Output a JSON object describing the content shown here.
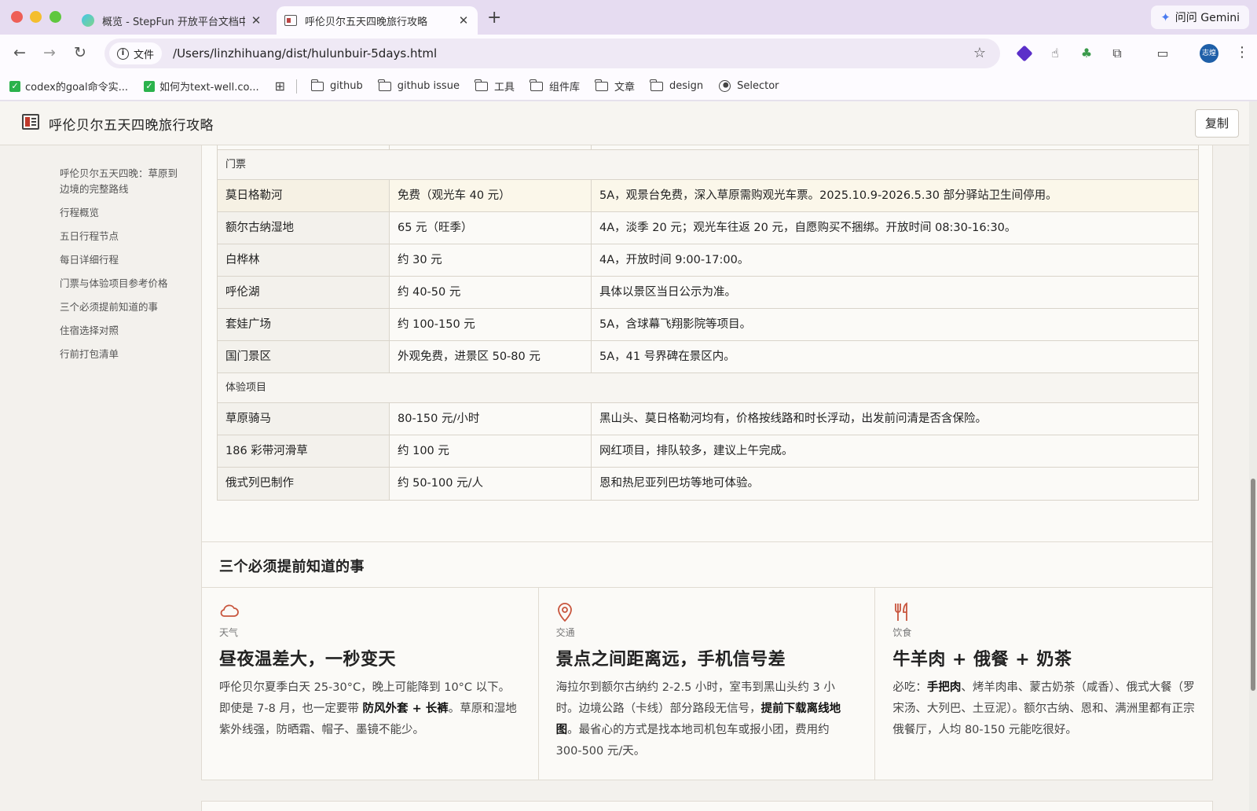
{
  "browser": {
    "tabs": [
      {
        "title": "概览 - StepFun 开放平台文档中",
        "active": false
      },
      {
        "title": "呼伦贝尔五天四晚旅行攻略",
        "active": true
      }
    ],
    "gemini_label": "问问 Gemini",
    "address": {
      "scheme_chip": "文件",
      "url": "/Users/linzhihuang/dist/hulunbuir-5days.html"
    },
    "avatar_text": "志煌",
    "bookmarks": [
      {
        "label": "codex的goal命令实...",
        "icon": "checkbox-icon"
      },
      {
        "label": "如何为text-well.co...",
        "icon": "checkbox-icon"
      },
      {
        "label": "github",
        "icon": "folder-icon"
      },
      {
        "label": "github issue",
        "icon": "folder-icon"
      },
      {
        "label": "工具",
        "icon": "folder-icon"
      },
      {
        "label": "组件库",
        "icon": "folder-icon"
      },
      {
        "label": "文章",
        "icon": "folder-icon"
      },
      {
        "label": "design",
        "icon": "folder-icon"
      },
      {
        "label": "Selector",
        "icon": "globe-icon"
      }
    ]
  },
  "page": {
    "title": "呼伦贝尔五天四晚旅行攻略",
    "copy_label": "复制",
    "toc": [
      "呼伦贝尔五天四晚：草原到边境的完整路线",
      "行程概览",
      "五日行程节点",
      "每日详细行程",
      "门票与体验项目参考价格",
      "三个必须提前知道的事",
      "住宿选择对照",
      "行前打包清单"
    ],
    "price_table": {
      "groups": [
        {
          "name": "门票",
          "rows": [
            {
              "item": "莫日格勒河",
              "price": "免费（观光车 40 元）",
              "note": "5A，观景台免费，深入草原需购观光车票。2025.10.9-2026.5.30 部分驿站卫生间停用。",
              "highlight": true
            },
            {
              "item": "额尔古纳湿地",
              "price": "65 元（旺季）",
              "note": "4A，淡季 20 元；观光车往返 20 元，自愿购买不捆绑。开放时间 08:30-16:30。"
            },
            {
              "item": "白桦林",
              "price": "约 30 元",
              "note": "4A，开放时间 9:00-17:00。"
            },
            {
              "item": "呼伦湖",
              "price": "约 40-50 元",
              "note": "具体以景区当日公示为准。"
            },
            {
              "item": "套娃广场",
              "price": "约 100-150 元",
              "note": "5A，含球幕飞翔影院等项目。"
            },
            {
              "item": "国门景区",
              "price": "外观免费，进景区 50-80 元",
              "note": "5A，41 号界碑在景区内。"
            }
          ]
        },
        {
          "name": "体验项目",
          "rows": [
            {
              "item": "草原骑马",
              "price": "80-150 元/小时",
              "note": "黑山头、莫日格勒河均有，价格按线路和时长浮动，出发前问清是否含保险。"
            },
            {
              "item": "186 彩带河滑草",
              "price": "约 100 元",
              "note": "网红项目，排队较多，建议上午完成。"
            },
            {
              "item": "俄式列巴制作",
              "price": "约 50-100 元/人",
              "note": "恩和热尼亚列巴坊等地可体验。"
            }
          ]
        }
      ]
    },
    "tips_section": {
      "title": "三个必须提前知道的事",
      "tips": [
        {
          "icon": "cloud-icon",
          "category": "天气",
          "headline": "昼夜温差大，一秒变天",
          "body": [
            {
              "t": "呼伦贝尔夏季白天 25-30°C，晚上可能降到 10°C 以下。即使是 7-8 月，也一定要带 ",
              "b": false
            },
            {
              "t": "防风外套 + 长裤",
              "b": true
            },
            {
              "t": "。草原和湿地紫外线强，防晒霜、帽子、墨镜不能少。",
              "b": false
            }
          ]
        },
        {
          "icon": "map-pin-icon",
          "category": "交通",
          "headline": "景点之间距离远，手机信号差",
          "body": [
            {
              "t": "海拉尔到额尔古纳约 2-2.5 小时，室韦到黑山头约 3 小时。边境公路（卡线）部分路段无信号，",
              "b": false
            },
            {
              "t": "提前下载离线地图",
              "b": true
            },
            {
              "t": "。最省心的方式是找本地司机包车或报小团，费用约 300-500 元/天。",
              "b": false
            }
          ]
        },
        {
          "icon": "utensils-icon",
          "category": "饮食",
          "headline": "牛羊肉 + 俄餐 + 奶茶",
          "body": [
            {
              "t": "必吃：",
              "b": false
            },
            {
              "t": "手把肉",
              "b": true
            },
            {
              "t": "、烤羊肉串、蒙古奶茶（咸香）、俄式大餐（罗宋汤、大列巴、土豆泥）。额尔古纳、恩和、满洲里都有正宗俄餐厅，人均 80-150 元能吃很好。",
              "b": false
            }
          ]
        }
      ]
    }
  }
}
